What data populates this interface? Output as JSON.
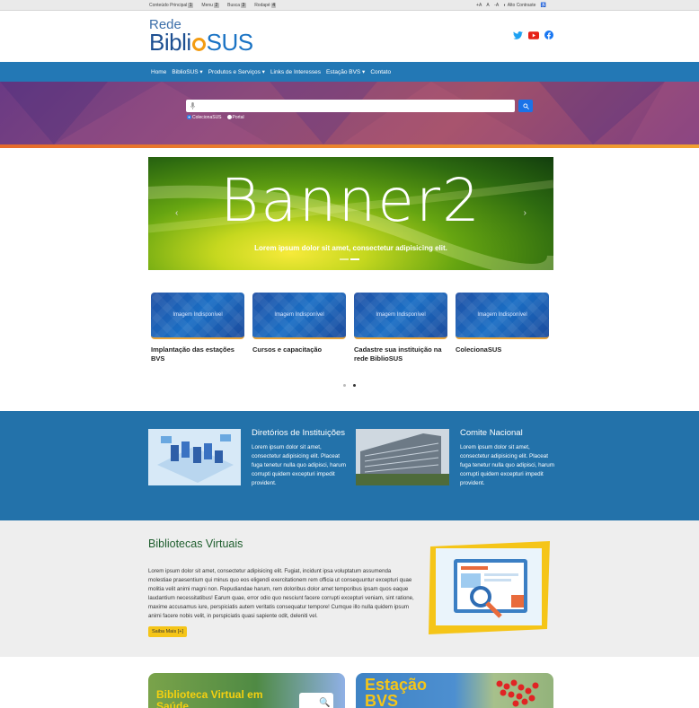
{
  "access_bar": {
    "left": [
      {
        "label": "Conteúdo Principal",
        "key": "1"
      },
      {
        "label": "Menu",
        "key": "2"
      },
      {
        "label": "Busca",
        "key": "3"
      },
      {
        "label": "Rodapé",
        "key": "4"
      }
    ],
    "font_plus": "+A",
    "font_normal": "A",
    "font_minus": "-A",
    "contrast": "Alto Contraste"
  },
  "logo": {
    "line1": "Rede",
    "part1": "Bibli",
    "part2": "SUS"
  },
  "social": {
    "twitter_color": "#1da1f2",
    "youtube_color": "#e62117",
    "facebook_color": "#1877f2"
  },
  "nav": [
    "Home",
    "BiblioSUS ▾",
    "Produtos e Serviços ▾",
    "Links de Interesses",
    "Estação BVS ▾",
    "Contato"
  ],
  "search": {
    "placeholder": "",
    "options": [
      "ColecionaSUS",
      "Portal"
    ]
  },
  "banner": {
    "title": "Banner2",
    "caption": "Lorem ipsum dolor sit amet, consectetur adipisicing elit."
  },
  "cards": [
    {
      "image_text": "Imagem Indisponível",
      "title": "Implantação das estações BVS"
    },
    {
      "image_text": "Imagem Indisponível",
      "title": "Cursos e capacitação"
    },
    {
      "image_text": "Imagem Indisponível",
      "title": "Cadastre sua instituição na rede BiblioSUS"
    },
    {
      "image_text": "Imagem Indisponível",
      "title": "ColecionaSUS"
    }
  ],
  "features": [
    {
      "title": "Diretórios de Instituições",
      "text": "Lorem ipsum dolor sit amet, consectetur adipisicing elit. Placeat fuga tenetur nulla quo adipisci, harum corrupti quidem excepturi impedit provident."
    },
    {
      "title": "Comite Nacional",
      "text": "Lorem ipsum dolor sit amet, consectetur adipisicing elit. Placeat fuga tenetur nulla quo adipisci, harum corrupti quidem excepturi impedit provident."
    }
  ],
  "virtual": {
    "title": "Bibliotecas Virtuais",
    "text": "Lorem ipsum dolor sit amet, consectetur adipisicing elit. Fugiat, incidunt ipsa voluptatum assumenda molestiae praesentium qui minus quo eos eligendi exercitationem rem officia ut consequuntur excepturi quae molitia velit animi magni non. Repudiandae harum, rem doloribus dolor amet temporibus ipsam quos eaque laudantium necessitatibus! Earum quae, error odio quo nesciunt facere corrupti excepturi veniam, sint ratione, maxime accusamus iure, perspiciatis autem veritatis consequatur tempore! Cumque illo nulla quidem ipsum animi facere nobis velit, in perspiciatis quasi sapiente odit, deleniti vel.",
    "button": "Saiba Mais [+]"
  },
  "bottom_cards": [
    {
      "title": "Biblioteca Virtual em Saúde"
    },
    {
      "title": "Estação BVS"
    }
  ],
  "colors": {
    "nav": "#2378b5",
    "accent": "#f39c12",
    "blue_section": "#2372aa"
  }
}
